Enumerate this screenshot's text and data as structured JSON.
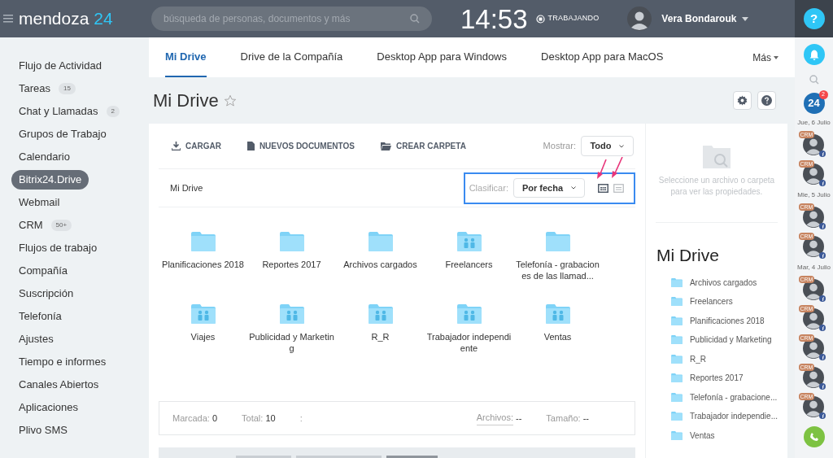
{
  "header": {
    "logo": {
      "name": "mendoza",
      "number": "24"
    },
    "search": {
      "placeholder": "búsqueda de personas, documentos y más"
    },
    "clock": "14:53",
    "status": "TRABAJANDO",
    "user": "Vera Bondarouk",
    "help": "?"
  },
  "sidebar": {
    "items": [
      {
        "label": "Flujo de Actividad",
        "selected": false
      },
      {
        "label": "Tareas",
        "badge": "15",
        "selected": false
      },
      {
        "label": "Chat y Llamadas",
        "badge": "2",
        "selected": false
      },
      {
        "label": "Grupos de Trabajo",
        "selected": false
      },
      {
        "label": "Calendario",
        "selected": false
      },
      {
        "label": "Bitrix24.Drive",
        "selected": true
      },
      {
        "label": "Webmail",
        "selected": false
      },
      {
        "label": "CRM",
        "badge": "50+",
        "selected": false
      },
      {
        "label": "Flujos de trabajo",
        "selected": false
      },
      {
        "label": "Compañía",
        "selected": false
      },
      {
        "label": "Suscripción",
        "selected": false
      },
      {
        "label": "Telefonía",
        "selected": false
      },
      {
        "label": "Ajustes",
        "selected": false
      },
      {
        "label": "Tiempo e informes",
        "selected": false
      },
      {
        "label": "Canales Abiertos",
        "selected": false
      },
      {
        "label": "Aplicaciones",
        "selected": false
      },
      {
        "label": "Plivo SMS",
        "selected": false
      }
    ]
  },
  "tabs": [
    {
      "label": "Mi Drive",
      "selected": true
    },
    {
      "label": "Drive de la Compañía",
      "selected": false
    },
    {
      "label": "Desktop App para Windows",
      "selected": false
    },
    {
      "label": "Desktop App para MacOS",
      "selected": false
    }
  ],
  "more_tab": "Más",
  "page_title": "Mi Drive",
  "toolbar": {
    "actions": [
      {
        "kind": "upload",
        "label": "CARGAR"
      },
      {
        "kind": "document",
        "label": "NUEVOS DOCUMENTOS"
      },
      {
        "kind": "folder",
        "label": "CREAR CARPETA"
      }
    ],
    "show_label": "Mostrar:",
    "show_value": "Todo"
  },
  "breadcrumb": "Mi Drive",
  "sort": {
    "label": "Clasificar:",
    "value": "Por fecha",
    "views": [
      {
        "kind": "grid",
        "selected": true
      },
      {
        "kind": "list",
        "selected": false
      }
    ]
  },
  "folders": [
    {
      "name": "Planificaciones 2018",
      "kind": "plain"
    },
    {
      "name": "Reportes 2017",
      "kind": "plain"
    },
    {
      "name": "Archivos cargados",
      "kind": "plain"
    },
    {
      "name": "Freelancers",
      "kind": "shared"
    },
    {
      "name": "Telefonía - grabaciones de las llamad...",
      "kind": "plain"
    },
    {
      "name": "Viajes",
      "kind": "shared"
    },
    {
      "name": "Publicidad y Marketing",
      "kind": "shared"
    },
    {
      "name": "R_R",
      "kind": "shared"
    },
    {
      "name": "Trabajador independiente",
      "kind": "shared"
    },
    {
      "name": "Ventas",
      "kind": "shared"
    }
  ],
  "stats": {
    "marked_label": "Marcada:",
    "marked": "0",
    "total_label": "Total:",
    "total": "10",
    "separator": ":",
    "files_label": "Archivos:",
    "files": "--",
    "size_label": "Tamaño:",
    "size": "--"
  },
  "properties": {
    "hint": "Seleccione un archivo o carpeta para ver las propiedades.",
    "tree_title": "Mi Drive",
    "tree": [
      "Archivos cargados",
      "Freelancers",
      "Planificaciones 2018",
      "Publicidad y Marketing",
      "R_R",
      "Reportes 2017",
      "Telefonía - grabacione...",
      "Trabajador independie...",
      "Ventas"
    ]
  },
  "right_bar": {
    "logo": "24",
    "logo_badge": "2",
    "groups": [
      {
        "date": "Jue, 6 Julio",
        "contacts": [
          {
            "tag": "CRM"
          },
          {
            "tag": "CRM"
          }
        ]
      },
      {
        "date": "Mie, 5 Julio",
        "contacts": [
          {
            "tag": "CRM"
          },
          {
            "tag": "CRM"
          }
        ]
      },
      {
        "date": "Mar, 4 Julio",
        "contacts": [
          {
            "tag": "CRM"
          },
          {
            "tag": "CRM"
          },
          {
            "tag": "CRM"
          },
          {
            "tag": "CRM"
          },
          {
            "tag": "CRM"
          }
        ]
      }
    ]
  }
}
